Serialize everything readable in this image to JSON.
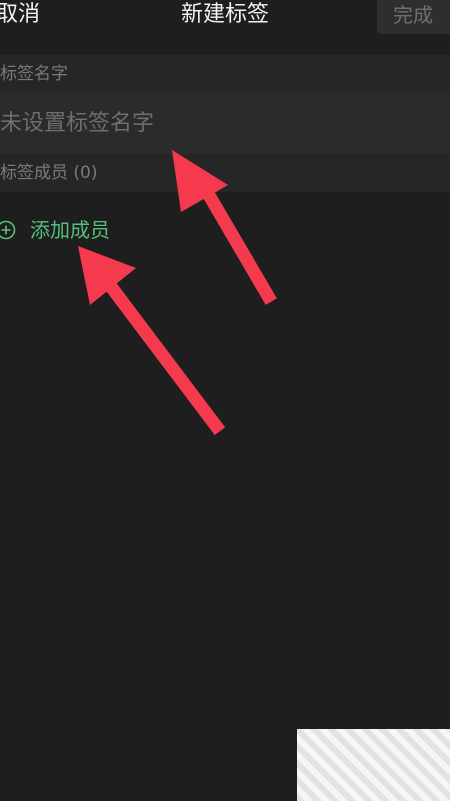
{
  "header": {
    "cancel_label": "取消",
    "title": "新建标签",
    "done_label": "完成"
  },
  "name_section": {
    "label": "标签名字",
    "placeholder": "未设置标签名字"
  },
  "members_section": {
    "label": "标签成员 (0)",
    "add_label": "添加成员"
  },
  "icons": {
    "add": "plus-circle-icon",
    "annotation": "red-arrow-icon"
  },
  "colors": {
    "background": "#1e1e1e",
    "accent_green": "#55c07a",
    "annotation_red": "#f53a4e"
  }
}
